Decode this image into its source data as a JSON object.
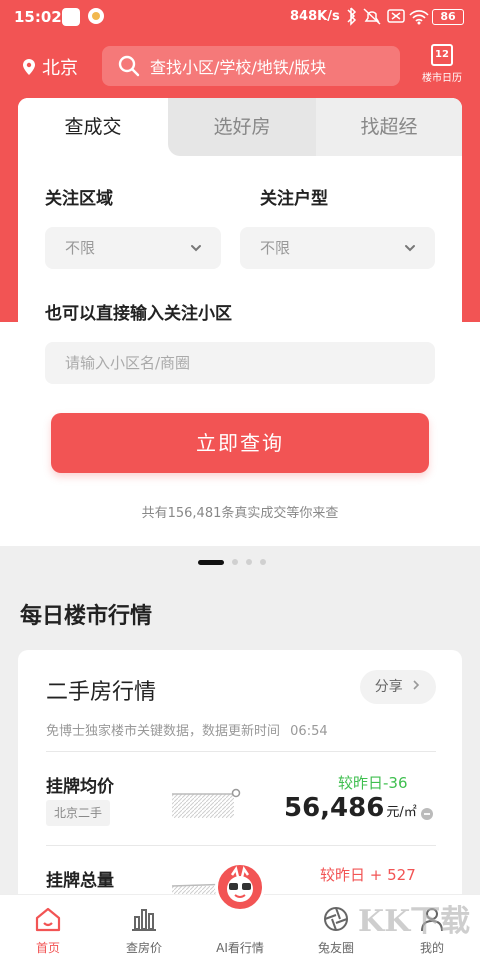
{
  "status_bar": {
    "time": "15:02",
    "speed": "848K/s",
    "battery": "86"
  },
  "header": {
    "location": "北京",
    "search_placeholder": "查找小区/学校/地铁/版块",
    "calendar_day": "12",
    "calendar_label": "楼市日历"
  },
  "query_card": {
    "tabs": [
      {
        "label": "查成交",
        "active": true
      },
      {
        "label": "选好房",
        "active": false
      },
      {
        "label": "找超经",
        "active": false
      }
    ],
    "area_label": "关注区域",
    "area_value": "不限",
    "type_label": "关注户型",
    "type_value": "不限",
    "community_label": "也可以直接输入关注小区",
    "community_placeholder": "请输入小区名/商圈",
    "submit_label": "立即查询",
    "count_text": "共有156,481条真实成交等你来查"
  },
  "section_title": "每日楼市行情",
  "market_card": {
    "title": "二手房行情",
    "share_label": "分享",
    "subtitle": "免博士独家楼市关键数据，数据更新时间",
    "update_time": "06:54",
    "rows": [
      {
        "label": "挂牌均价",
        "tag": "北京二手",
        "change": "较昨日-36",
        "value": "56,486",
        "unit": "元/㎡"
      },
      {
        "label": "挂牌总量",
        "change": "较昨日 + 527"
      }
    ]
  },
  "bottom_nav": [
    {
      "label": "首页",
      "icon": "home-icon",
      "active": true
    },
    {
      "label": "查房价",
      "icon": "bar-chart-icon",
      "active": false
    },
    {
      "label": "AI看行情",
      "icon": "ai-mascot-icon",
      "active": false
    },
    {
      "label": "兔友圈",
      "icon": "aperture-icon",
      "active": false
    },
    {
      "label": "我的",
      "icon": "user-icon",
      "active": false
    }
  ],
  "watermark": "KK下载",
  "colors": {
    "brand_red": "#f25454",
    "down_green": "#3fbf4f"
  }
}
